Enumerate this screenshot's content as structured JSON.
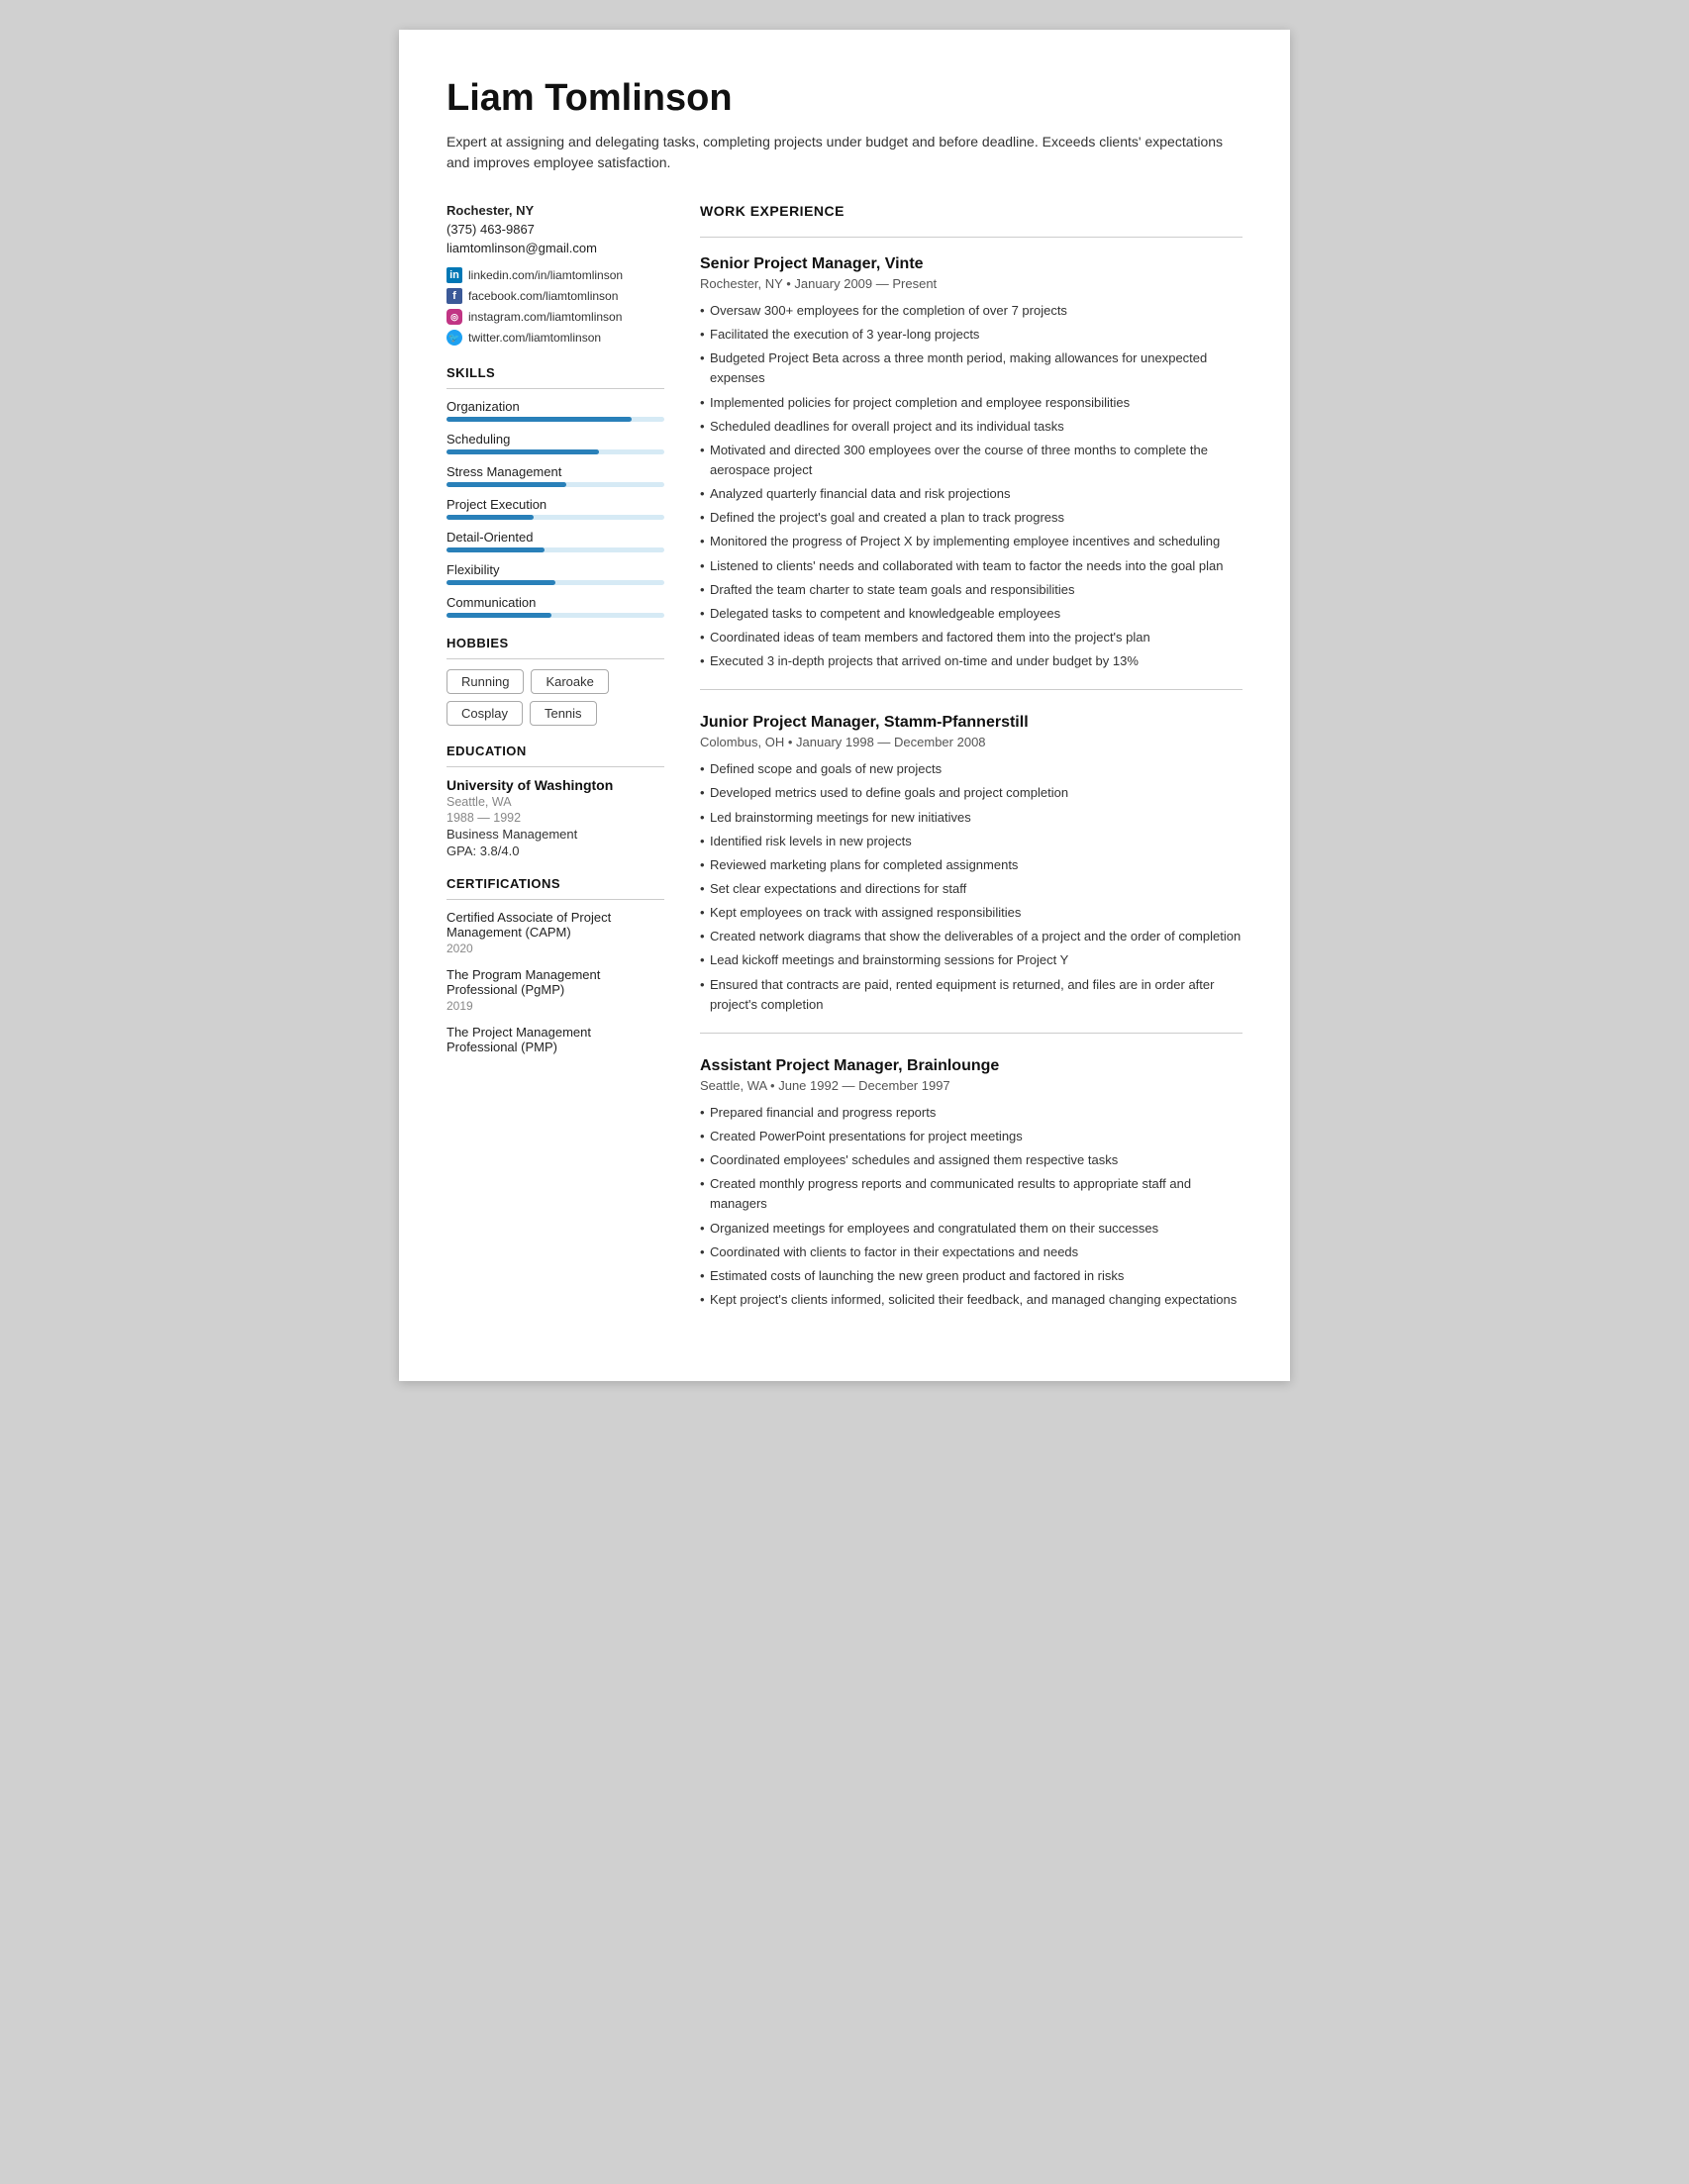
{
  "header": {
    "name": "Liam Tomlinson",
    "summary": "Expert at assigning and delegating tasks, completing projects under budget and before deadline. Exceeds clients' expectations and improves employee satisfaction."
  },
  "contact": {
    "location": "Rochester, NY",
    "phone": "(375) 463-9867",
    "email": "liamtomlinson@gmail.com"
  },
  "socials": [
    {
      "platform": "linkedin",
      "label": "linkedin.com/in/liamtomlinson",
      "icon": "in"
    },
    {
      "platform": "facebook",
      "label": "facebook.com/liamtomlinson",
      "icon": "f"
    },
    {
      "platform": "instagram",
      "label": "instagram.com/liamtomlinson",
      "icon": "◎"
    },
    {
      "platform": "twitter",
      "label": "twitter.com/liamtomlinson",
      "icon": "🐦"
    }
  ],
  "skills_label": "SKILLS",
  "skills": [
    {
      "name": "Organization",
      "level": 85
    },
    {
      "name": "Scheduling",
      "level": 70
    },
    {
      "name": "Stress Management",
      "level": 55
    },
    {
      "name": "Project Execution",
      "level": 40
    },
    {
      "name": "Detail-Oriented",
      "level": 45
    },
    {
      "name": "Flexibility",
      "level": 50
    },
    {
      "name": "Communication",
      "level": 48
    }
  ],
  "hobbies_label": "HOBBIES",
  "hobbies": [
    "Running",
    "Karoake",
    "Cosplay",
    "Tennis"
  ],
  "education_label": "EDUCATION",
  "education": [
    {
      "school": "University of Washington",
      "location": "Seattle, WA",
      "years": "1988 — 1992",
      "field": "Business Management",
      "gpa": "GPA: 3.8/4.0"
    }
  ],
  "certifications_label": "CERTIFICATIONS",
  "certifications": [
    {
      "name": "Certified Associate of Project Management (CAPM)",
      "year": "2020"
    },
    {
      "name": "The Program Management Professional (PgMP)",
      "year": "2019"
    },
    {
      "name": "The Project Management Professional (PMP)",
      "year": ""
    }
  ],
  "work_experience_label": "WORK EXPERIENCE",
  "jobs": [
    {
      "title": "Senior Project Manager, Vinte",
      "meta": "Rochester, NY • January 2009 — Present",
      "bullets": [
        "Oversaw 300+ employees for the completion of over 7 projects",
        "Facilitated the execution of 3 year-long projects",
        "Budgeted Project Beta across a three month period, making allowances for unexpected expenses",
        "Implemented policies for project completion and employee responsibilities",
        "Scheduled deadlines for overall project and its individual tasks",
        "Motivated and directed 300 employees over the course of three months to complete the aerospace project",
        "Analyzed quarterly financial data and risk projections",
        "Defined the project's goal and created a plan to track progress",
        "Monitored the progress of Project X by implementing employee incentives and scheduling",
        "Listened to clients' needs and collaborated with team to factor the needs into the goal plan",
        "Drafted the team charter to state team goals and responsibilities",
        "Delegated tasks to competent and knowledgeable employees",
        "Coordinated ideas of team members and factored them into the project's plan",
        "Executed 3 in-depth projects that arrived on-time and under budget by 13%"
      ]
    },
    {
      "title": "Junior Project Manager, Stamm-Pfannerstill",
      "meta": "Colombus, OH • January 1998 — December 2008",
      "bullets": [
        "Defined scope and goals of new projects",
        "Developed metrics used to define goals and project completion",
        "Led brainstorming meetings for new initiatives",
        "Identified risk levels in new projects",
        "Reviewed marketing plans for completed assignments",
        "Set clear expectations and directions for staff",
        "Kept employees on track with assigned responsibilities",
        "Created network diagrams that show the deliverables of a project and the order of completion",
        "Lead kickoff meetings and brainstorming sessions for Project Y",
        "Ensured that contracts are paid, rented equipment is returned, and files are in order after project's completion"
      ]
    },
    {
      "title": "Assistant Project Manager, Brainlounge",
      "meta": "Seattle, WA • June 1992 — December 1997",
      "bullets": [
        "Prepared financial and progress reports",
        "Created PowerPoint presentations for project meetings",
        "Coordinated employees' schedules and assigned them respective tasks",
        "Created monthly progress reports and communicated results to appropriate staff and managers",
        "Organized meetings for employees and congratulated them on their successes",
        "Coordinated with clients to factor in their expectations and needs",
        "Estimated costs of launching the new green product and factored in risks",
        "Kept project's clients informed, solicited their feedback, and managed changing expectations"
      ]
    }
  ]
}
